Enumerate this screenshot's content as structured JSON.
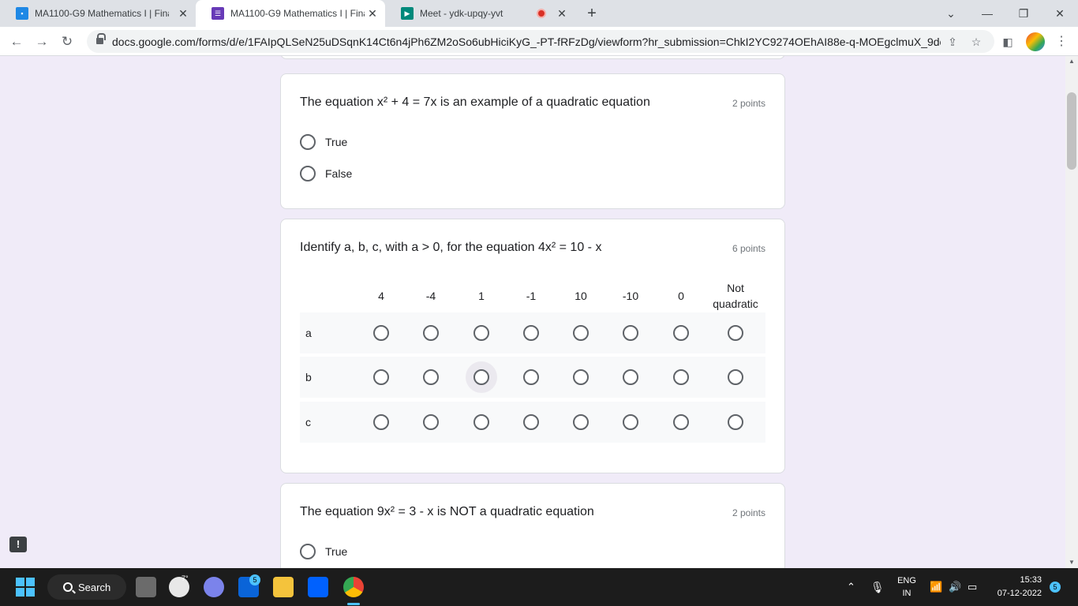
{
  "tabs": [
    {
      "title": "MA1100-G9 Mathematics I | Final",
      "favicon": "classroom-icon",
      "active": false
    },
    {
      "title": "MA1100-G9 Mathematics I | Final",
      "favicon": "forms-icon",
      "active": true
    },
    {
      "title": "Meet - ydk-upqy-yvt",
      "favicon": "meet-icon",
      "active": false,
      "recording": true
    }
  ],
  "address_bar": {
    "url": "docs.google.com/forms/d/e/1FAIpQLSeN25uDSqnK14Ct6n4jPh6ZM2oSo6ubHiciKyG_-PT-fRFzDg/viewform?hr_submission=ChkI2YC9274OEhAI88e-q-MOEgclmuX_9dcP..."
  },
  "questions": [
    {
      "title": "The equation x² + 4 = 7x is an example of a quadratic equation",
      "points": "2 points",
      "options": [
        "True",
        "False"
      ]
    },
    {
      "title": "Identify a, b, c, with a > 0, for the equation 4x² = 10 - x",
      "points": "6 points",
      "columns": [
        "4",
        "-4",
        "1",
        "-1",
        "10",
        "-10",
        "0",
        "Not quadratic"
      ],
      "rows": [
        "a",
        "b",
        "c"
      ],
      "hovered": {
        "row": 1,
        "col": 2
      }
    },
    {
      "title": "The equation 9x² = 3 - x is NOT a quadratic equation",
      "points": "2 points",
      "options": [
        "True"
      ]
    }
  ],
  "taskbar": {
    "search_label": "Search",
    "weather_temp": "7°",
    "teams_badge": "5",
    "language_top": "ENG",
    "language_bottom": "IN",
    "time": "15:33",
    "date": "07-12-2022",
    "notification_count": "5"
  },
  "colors": {
    "page_background": "#f0ebf8",
    "forms_purple": "#673ab7",
    "recording_red": "#d93025",
    "taskbar": "#1c1c1c"
  }
}
